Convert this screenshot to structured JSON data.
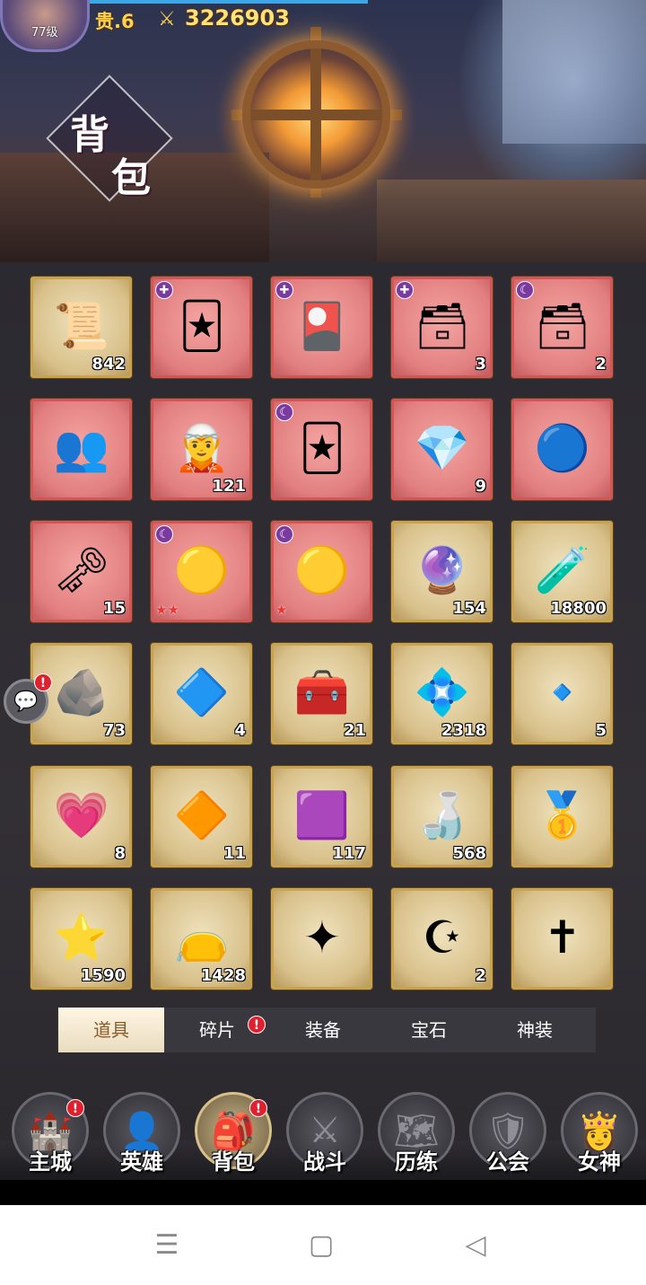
{
  "header": {
    "level": "77级",
    "vip": "贵.6",
    "power_icon": "crossed-swords-icon",
    "power": "3226903"
  },
  "page_title": {
    "char1": "背",
    "char2": "包"
  },
  "items": [
    {
      "count": "842",
      "icon": "scroll-icon",
      "glyph": "📜",
      "bg": "gold"
    },
    {
      "count": "",
      "icon": "card-box-icon",
      "glyph": "🃏",
      "bg": "red",
      "tag": "✚"
    },
    {
      "count": "",
      "icon": "cards-icon",
      "glyph": "🎴",
      "bg": "red",
      "tag": "✚"
    },
    {
      "count": "3",
      "icon": "card-chest-icon",
      "glyph": "🗃",
      "bg": "red",
      "tag": "✚"
    },
    {
      "count": "2",
      "icon": "card-chest-icon",
      "glyph": "🗃",
      "bg": "red",
      "tag": "☾"
    },
    {
      "count": "",
      "icon": "heroes-portrait-icon",
      "glyph": "👥",
      "bg": "red"
    },
    {
      "count": "121",
      "icon": "hero-fragment-icon",
      "glyph": "🧝",
      "bg": "red"
    },
    {
      "count": "",
      "icon": "card-box-icon",
      "glyph": "🃏",
      "bg": "red",
      "tag": "☾"
    },
    {
      "count": "9",
      "icon": "crystal-icon",
      "glyph": "💎",
      "bg": "red"
    },
    {
      "count": "",
      "icon": "blue-gem-icon",
      "glyph": "🔵",
      "bg": "red"
    },
    {
      "count": "15",
      "icon": "key-icon",
      "glyph": "🗝",
      "bg": "red"
    },
    {
      "count": "",
      "icon": "ring-icon",
      "glyph": "🟡",
      "bg": "red",
      "tag": "☾",
      "stars": "★★"
    },
    {
      "count": "",
      "icon": "ring-icon",
      "glyph": "🟡",
      "bg": "red",
      "tag": "☾",
      "stars": "★"
    },
    {
      "count": "154",
      "icon": "rune-stone-icon",
      "glyph": "🔮",
      "bg": "gold"
    },
    {
      "count": "18800",
      "icon": "potion-vial-icon",
      "glyph": "🧪",
      "bg": "gold"
    },
    {
      "count": "73",
      "icon": "amber-ore-icon",
      "glyph": "🪨",
      "bg": "gold"
    },
    {
      "count": "4",
      "icon": "blue-stone-icon",
      "glyph": "🔷",
      "bg": "gold"
    },
    {
      "count": "21",
      "icon": "treasure-chest-icon",
      "glyph": "🧰",
      "bg": "gold"
    },
    {
      "count": "2318",
      "icon": "diamond-icon",
      "glyph": "💠",
      "bg": "gold"
    },
    {
      "count": "5",
      "icon": "pendant-icon",
      "glyph": "🔹",
      "bg": "gold"
    },
    {
      "count": "8",
      "icon": "pink-gem-icon",
      "glyph": "💗",
      "bg": "gold"
    },
    {
      "count": "11",
      "icon": "prism-crystal-icon",
      "glyph": "🔶",
      "bg": "gold"
    },
    {
      "count": "117",
      "icon": "magic-cube-icon",
      "glyph": "🟪",
      "bg": "gold"
    },
    {
      "count": "568",
      "icon": "elixir-bottle-icon",
      "glyph": "🍶",
      "bg": "gold"
    },
    {
      "count": "",
      "icon": "gold-nugget-icon",
      "glyph": "🥇",
      "bg": "gold"
    },
    {
      "count": "1590",
      "icon": "shard-icon",
      "glyph": "⭐",
      "bg": "gold"
    },
    {
      "count": "1428",
      "icon": "pouch-icon",
      "glyph": "👝",
      "bg": "gold"
    },
    {
      "count": "",
      "icon": "skill-book-icon",
      "glyph": "✦",
      "bg": "gold"
    },
    {
      "count": "2",
      "icon": "skill-book-icon",
      "glyph": "☪",
      "bg": "gold"
    },
    {
      "count": "",
      "icon": "skill-book-icon",
      "glyph": "✝",
      "bg": "gold"
    }
  ],
  "tabs": [
    "道具",
    "碎片",
    "装备",
    "宝石",
    "神装"
  ],
  "nav": [
    {
      "label": "主城",
      "icon": "castle-icon",
      "glyph": "🏰",
      "badge": "!"
    },
    {
      "label": "英雄",
      "icon": "hero-hood-icon",
      "glyph": "👤"
    },
    {
      "label": "背包",
      "icon": "backpack-icon",
      "glyph": "🎒",
      "badge": "!"
    },
    {
      "label": "战斗",
      "icon": "crossed-swords-icon",
      "glyph": "⚔"
    },
    {
      "label": "历练",
      "icon": "map-icon",
      "glyph": "🗺"
    },
    {
      "label": "公会",
      "icon": "guild-shield-icon",
      "glyph": "🛡"
    },
    {
      "label": "女神",
      "icon": "goddess-icon",
      "glyph": "👸"
    }
  ],
  "badges": {
    "alert": "!"
  },
  "system_nav": {
    "menu": "☰",
    "home": "▢",
    "back": "◁"
  }
}
